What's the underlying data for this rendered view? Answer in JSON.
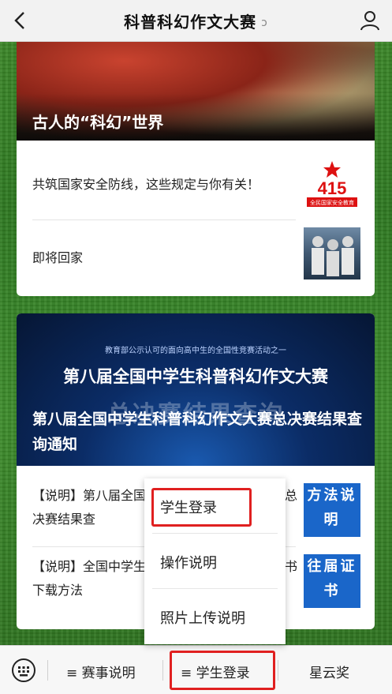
{
  "header": {
    "title": "科普科幻作文大赛",
    "ear_icon": "ear-icon"
  },
  "card1": {
    "hero_title": "古人的“科幻”世界",
    "items": [
      {
        "text": "共筑国家安全防线，这些规定与你有关！",
        "thumb_label": "415",
        "thumb_sub": "全民国家安全教育"
      },
      {
        "text": "即将回家"
      }
    ]
  },
  "card2": {
    "hero_top": "教育部公示认可的面向高中生的全国性竞赛活动之一",
    "hero_main": "第八届全国中学生科普科幻作文大赛",
    "hero_big": "总决赛结果查询",
    "hero_title": "第八届全国中学生科普科幻作文大赛总决赛结果查询通知",
    "notes": [
      {
        "text": "【说明】第八届全国中学生科普科幻作文大赛总决赛结果查",
        "button": "方法说明"
      },
      {
        "text": "【说明】全国中学生科普科幻作文大赛往届证书下载方法",
        "button": "往届证书"
      }
    ]
  },
  "popup": {
    "items": [
      "学生登录",
      "操作说明",
      "照片上传说明"
    ]
  },
  "bottom_bar": {
    "tabs": [
      "≡ 赛事说明",
      "≡ 学生登录",
      "星云奖"
    ]
  },
  "colors": {
    "accent_blue": "#1a66c9",
    "highlight_red": "#e02020"
  }
}
